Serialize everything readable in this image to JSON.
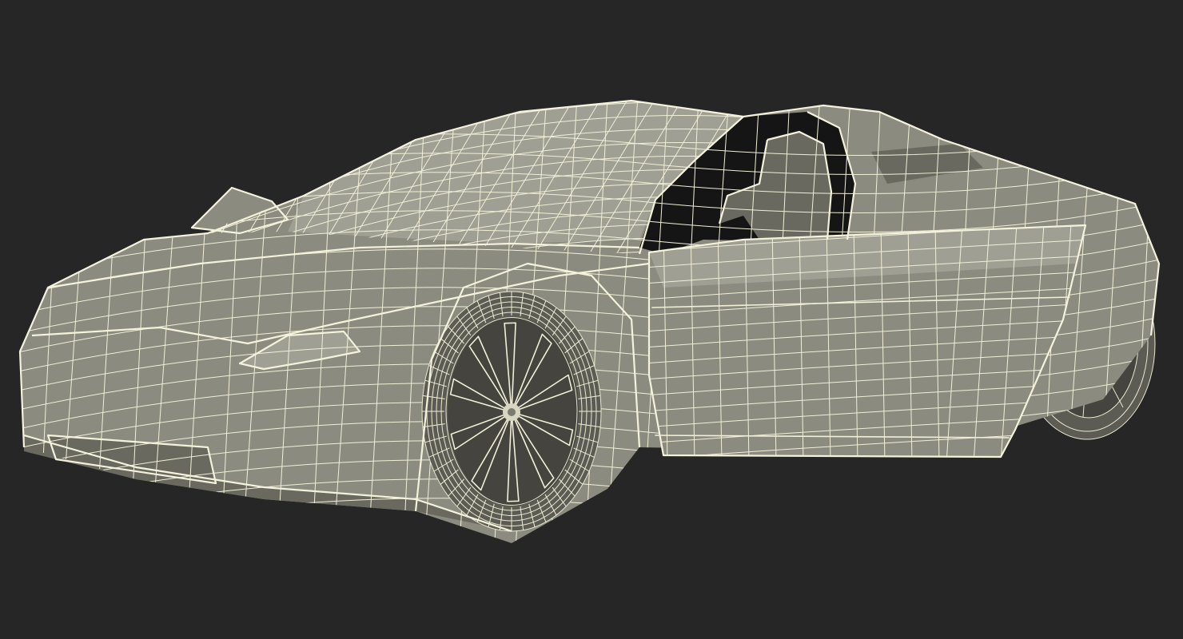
{
  "scene": {
    "background_color": "#262626",
    "mesh_fill_color": "#8c8b7f",
    "wire_color": "#f1efd8",
    "subject": "sports-car-wireframe-render",
    "door_state": "open"
  }
}
